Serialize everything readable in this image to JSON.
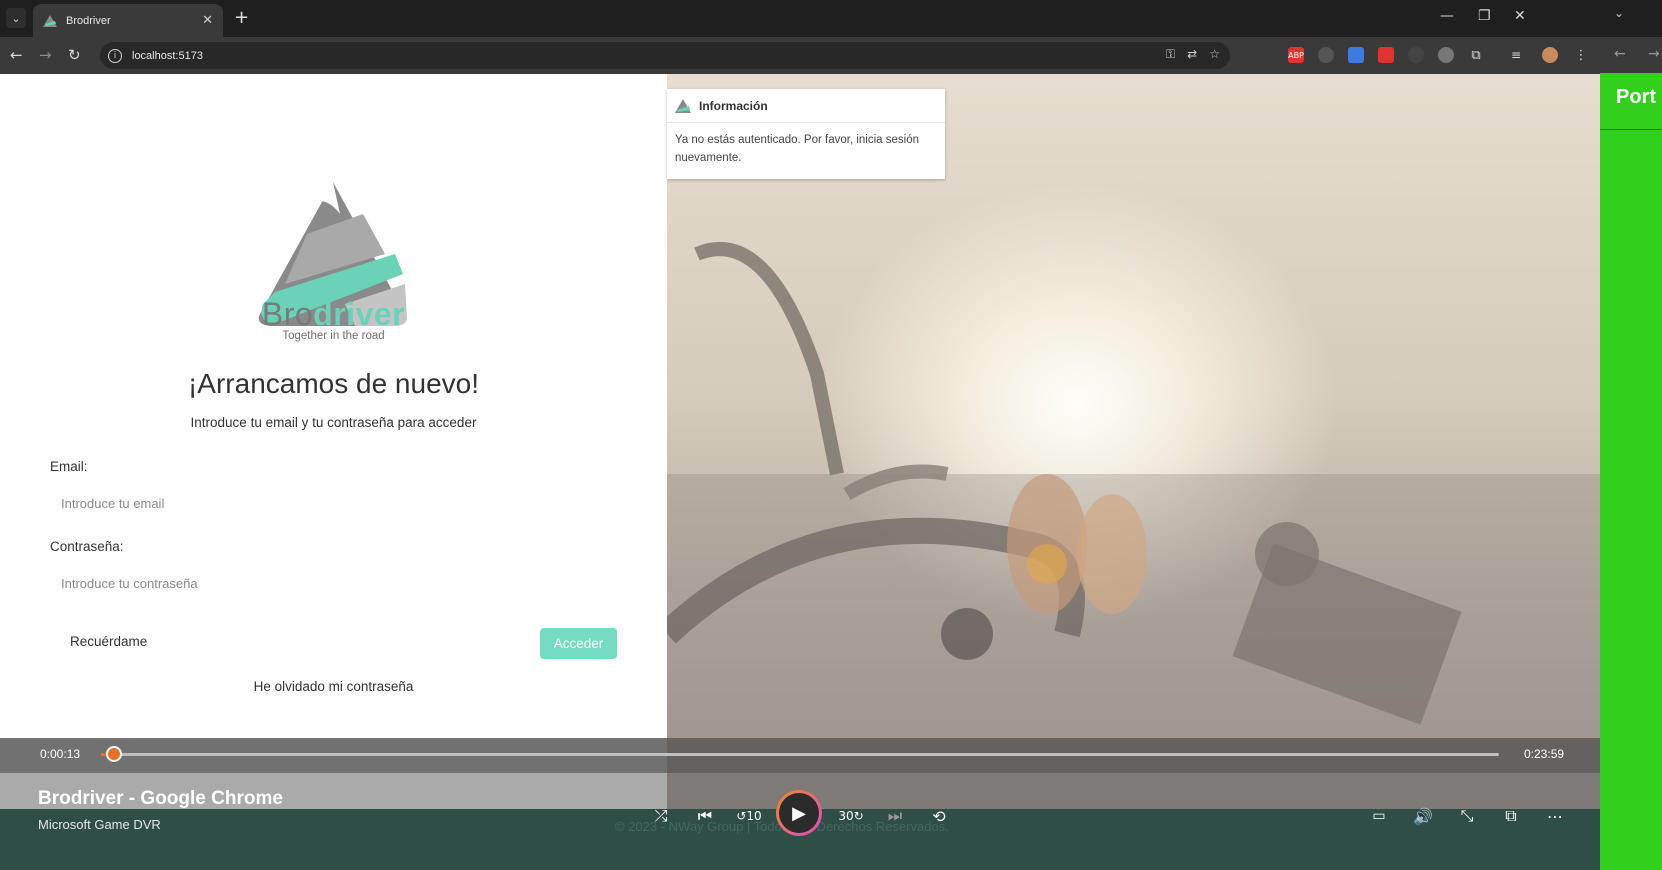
{
  "browser": {
    "tab_title": "Brodriver",
    "url": "localhost:5173"
  },
  "login": {
    "brand_light": "Bro",
    "brand_bold": "driver",
    "tagline": "Together in the road",
    "headline": "¡Arrancamos de nuevo!",
    "subtext": "Introduce tu email y tu contraseña para acceder",
    "email_label": "Email:",
    "email_placeholder": "Introduce tu email",
    "password_label": "Contraseña:",
    "password_placeholder": "Introduce tu contraseña",
    "remember_label": "Recuérdame",
    "submit_label": "Acceder",
    "forgot_label": "He olvidado mi contraseña"
  },
  "toast": {
    "title": "Información",
    "message": "Ya no estás autenticado. Por favor, inicia sesión nuevamente."
  },
  "footer": {
    "copyright": "© 2023 - NWay Group | Todos Los Derechos Reservados."
  },
  "dvr": {
    "elapsed": "0:00:13",
    "duration": "0:23:59",
    "progress_fraction": 0.009,
    "title": "Brodriver - Google Chrome",
    "source": "Microsoft Game DVR"
  },
  "side_window": {
    "text": "Port"
  },
  "colors": {
    "accent": "#6ad2b7",
    "dvr_accent": "#e3712a",
    "side_green": "#32d01c"
  }
}
